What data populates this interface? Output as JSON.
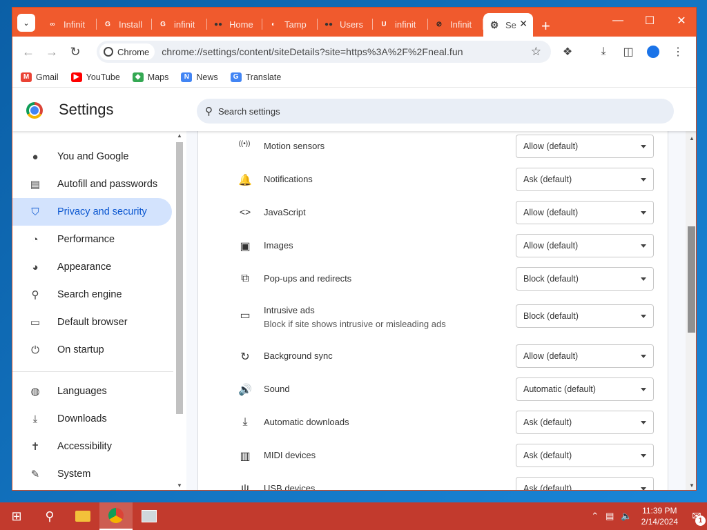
{
  "browser": {
    "tabs": [
      {
        "title": "Infinit",
        "icon": "infinity-icon",
        "color": "#ffffff"
      },
      {
        "title": "Install",
        "icon": "google-icon",
        "color": "#ffffff"
      },
      {
        "title": "infinit",
        "icon": "google-icon",
        "color": "#ffffff"
      },
      {
        "title": "Home",
        "icon": "tampermonkey-icon",
        "color": "#333333"
      },
      {
        "title": "Tamp",
        "icon": "tamp-icon",
        "color": "#ffffff"
      },
      {
        "title": "Users",
        "icon": "tampermonkey-icon",
        "color": "#333333"
      },
      {
        "title": "infinit",
        "icon": "usz-icon",
        "color": "#ffffff"
      },
      {
        "title": "Infinit",
        "icon": "slash-icon",
        "color": "#222222"
      }
    ],
    "active_tab": {
      "title": "Se",
      "icon": "gear-icon"
    },
    "new_tab_label": "+",
    "window_controls": {
      "minimize": "—",
      "maximize": "☐",
      "close": "✕"
    },
    "omnibox": {
      "chip": "Chrome",
      "url": "chrome://settings/content/siteDetails?site=https%3A%2F%2Fneal.fun"
    },
    "bookmarks": [
      {
        "label": "Gmail",
        "icon": "gmail-icon",
        "color": "#ea4335"
      },
      {
        "label": "YouTube",
        "icon": "youtube-icon",
        "color": "#ff0000"
      },
      {
        "label": "Maps",
        "icon": "maps-icon",
        "color": "#34a853"
      },
      {
        "label": "News",
        "icon": "news-icon",
        "color": "#4285f4"
      },
      {
        "label": "Translate",
        "icon": "translate-icon",
        "color": "#4285f4"
      }
    ],
    "accent": "#f05a2d"
  },
  "settings": {
    "title": "Settings",
    "search_placeholder": "Search settings",
    "sidebar": [
      {
        "label": "You and Google",
        "icon": "person-icon"
      },
      {
        "label": "Autofill and passwords",
        "icon": "clipboard-icon"
      },
      {
        "label": "Privacy and security",
        "icon": "shield-icon",
        "selected": true
      },
      {
        "label": "Performance",
        "icon": "speedometer-icon"
      },
      {
        "label": "Appearance",
        "icon": "palette-icon"
      },
      {
        "label": "Search engine",
        "icon": "search-icon"
      },
      {
        "label": "Default browser",
        "icon": "browser-icon"
      },
      {
        "label": "On startup",
        "icon": "power-icon"
      }
    ],
    "sidebar_secondary": [
      {
        "label": "Languages",
        "icon": "globe-icon"
      },
      {
        "label": "Downloads",
        "icon": "download-icon"
      },
      {
        "label": "Accessibility",
        "icon": "accessibility-icon"
      },
      {
        "label": "System",
        "icon": "wrench-icon"
      }
    ],
    "permissions": [
      {
        "label": "Motion sensors",
        "icon": "motion-sensor-icon",
        "value": "Allow (default)"
      },
      {
        "label": "Notifications",
        "icon": "bell-icon",
        "value": "Ask (default)"
      },
      {
        "label": "JavaScript",
        "icon": "code-icon",
        "value": "Allow (default)"
      },
      {
        "label": "Images",
        "icon": "image-icon",
        "value": "Allow (default)"
      },
      {
        "label": "Pop-ups and redirects",
        "icon": "popup-icon",
        "value": "Block (default)"
      },
      {
        "label": "Intrusive ads",
        "sublabel": "Block if site shows intrusive or misleading ads",
        "icon": "ads-window-icon",
        "value": "Block (default)"
      },
      {
        "label": "Background sync",
        "icon": "sync-icon",
        "value": "Allow (default)"
      },
      {
        "label": "Sound",
        "icon": "speaker-icon",
        "value": "Automatic (default)"
      },
      {
        "label": "Automatic downloads",
        "icon": "download-icon",
        "value": "Ask (default)"
      },
      {
        "label": "MIDI devices",
        "icon": "piano-icon",
        "value": "Ask (default)"
      },
      {
        "label": "USB devices",
        "icon": "usb-icon",
        "value": "Ask (default)"
      }
    ]
  },
  "taskbar": {
    "time": "11:39 PM",
    "date": "2/14/2024",
    "notification_count": "1",
    "color": "#c23a2d"
  }
}
